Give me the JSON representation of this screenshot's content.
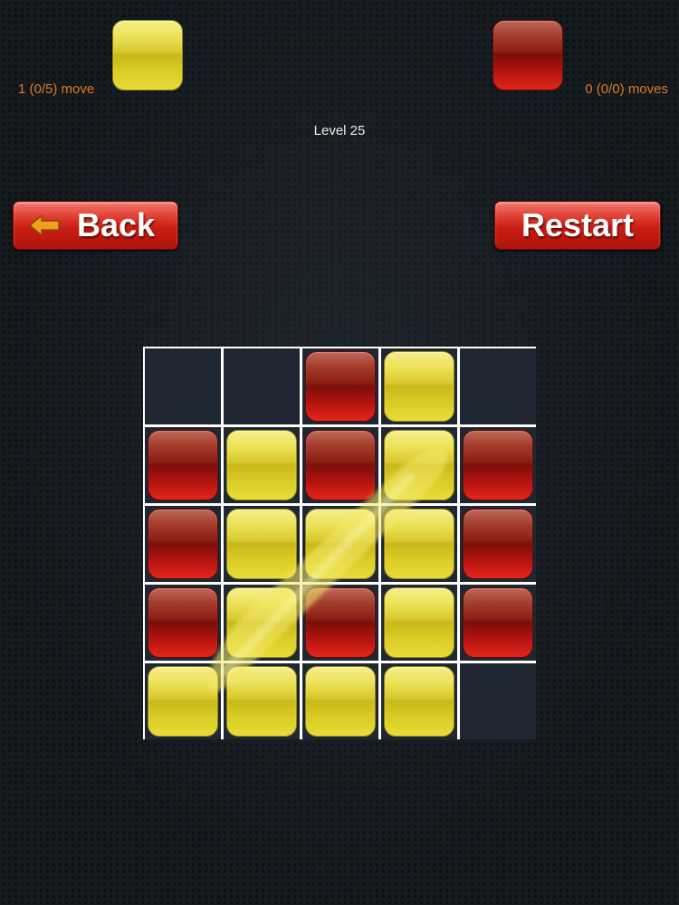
{
  "players": {
    "yellow": {
      "color": "yellow",
      "move_text": "1 (0/5) move"
    },
    "red": {
      "color": "red",
      "move_text": "0 (0/0) moves"
    }
  },
  "level": {
    "label": "Level 25"
  },
  "buttons": {
    "back": {
      "label": "Back",
      "icon": "arrow-left-icon"
    },
    "restart": {
      "label": "Restart"
    }
  },
  "colors": {
    "yellow_tile": "#e3d43a",
    "red_tile": "#b3120d",
    "empty_cell": "#1f2733",
    "grid_line": "#ffffff",
    "move_text": "#e07a22",
    "level_text": "#e8e8e8",
    "button": "#d3271c",
    "back_arrow": "#f0a020"
  },
  "board": {
    "size": 5,
    "rows": [
      [
        "empty",
        "empty",
        "red",
        "yellow",
        "empty"
      ],
      [
        "red",
        "yellow",
        "red",
        "yellow",
        "red"
      ],
      [
        "red",
        "yellow",
        "yellow",
        "yellow",
        "red"
      ],
      [
        "red",
        "yellow",
        "red",
        "yellow",
        "red"
      ],
      [
        "yellow",
        "yellow",
        "yellow",
        "yellow",
        "empty"
      ]
    ],
    "swipe_trail": {
      "from": [
        4,
        0
      ],
      "to": [
        1,
        3
      ]
    }
  }
}
